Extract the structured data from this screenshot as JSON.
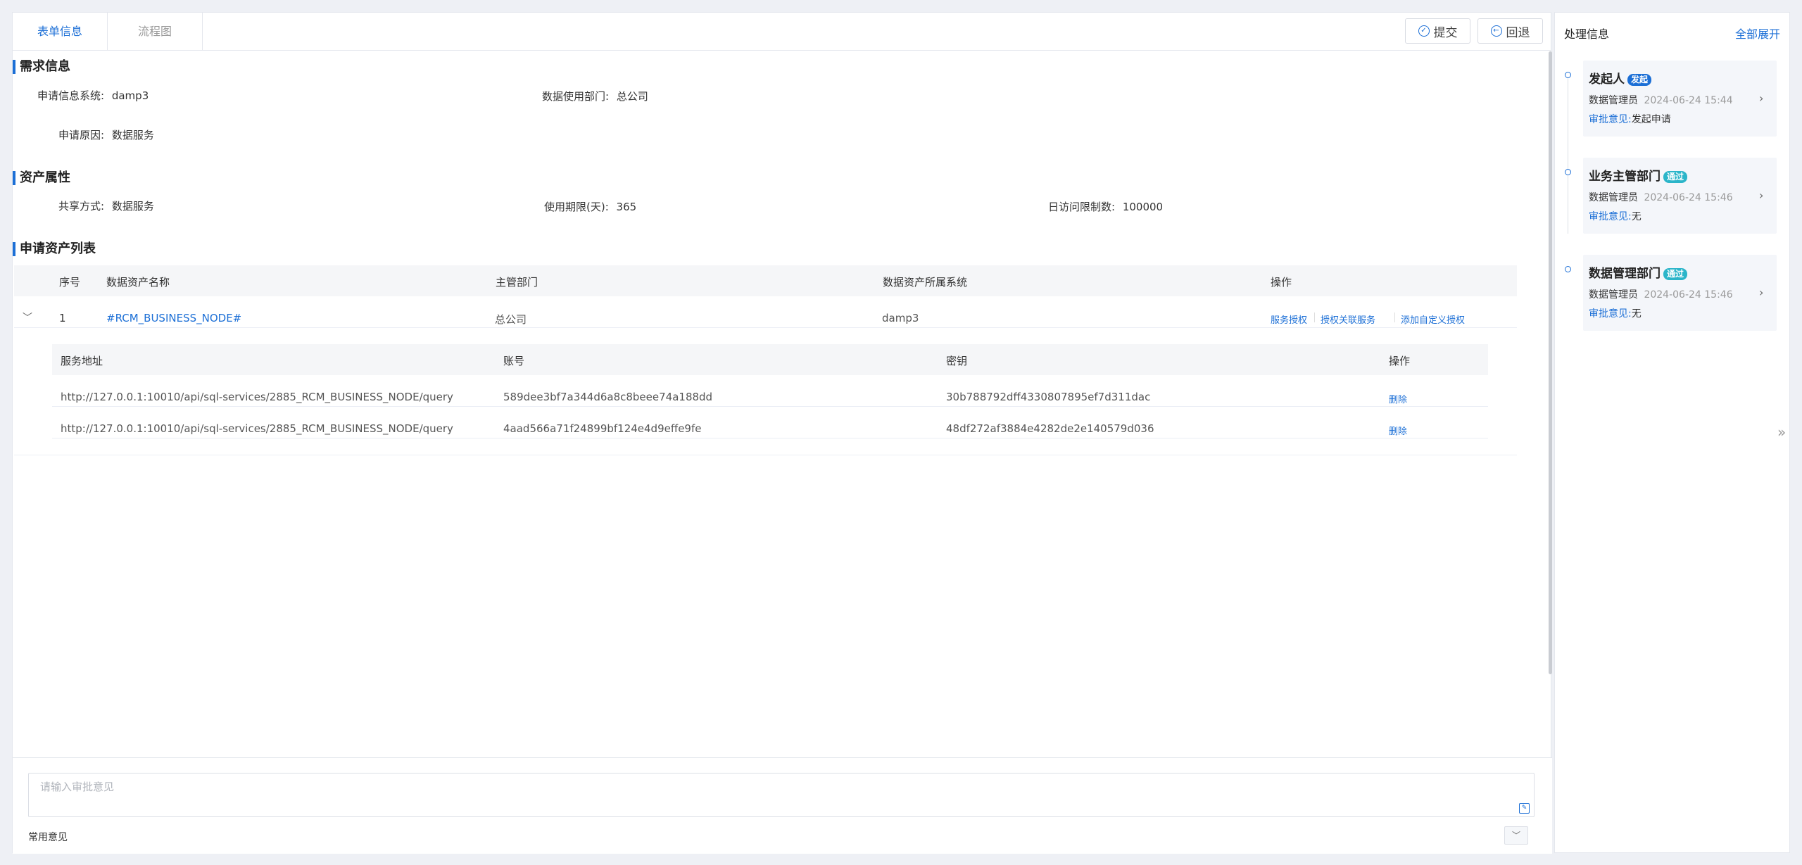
{
  "tabs": [
    {
      "label": "表单信息",
      "active": true
    },
    {
      "label": "流程图",
      "active": false
    }
  ],
  "toolbar": {
    "submit_label": "提交",
    "back_label": "回退"
  },
  "sections": {
    "demand": "需求信息",
    "asset_props": "资产属性",
    "asset_list": "申请资产列表"
  },
  "demand": {
    "system_label": "申请信息系统:",
    "system_value": "damp3",
    "dept_label": "数据使用部门:",
    "dept_value": "总公司",
    "reason_label": "申请原因:",
    "reason_value": "数据服务"
  },
  "asset_props": {
    "share_label": "共享方式:",
    "share_value": "数据服务",
    "period_label": "使用期限(天):",
    "period_value": "365",
    "limit_label": "日访问限制数:",
    "limit_value": "100000"
  },
  "asset_table": {
    "headers": [
      "序号",
      "数据资产名称",
      "主管部门",
      "数据资产所属系统",
      "操作"
    ],
    "rows": [
      {
        "index": "1",
        "name": "#RCM_BUSINESS_NODE#",
        "dept": "总公司",
        "system": "damp3",
        "actions": [
          "服务授权",
          "授权关联服务",
          "添加自定义授权"
        ]
      }
    ]
  },
  "service_table": {
    "headers": [
      "服务地址",
      "账号",
      "密钥",
      "操作"
    ],
    "rows": [
      {
        "url": "http://127.0.0.1:10010/api/sql-services/2885_RCM_BUSINESS_NODE/query",
        "account": "589dee3bf7a344d6a8c8beee74a188dd",
        "secret": "30b788792dff4330807895ef7d311dac",
        "action": "删除"
      },
      {
        "url": "http://127.0.0.1:10010/api/sql-services/2885_RCM_BUSINESS_NODE/query",
        "account": "4aad566a71f24899bf124e4d9effe9fe",
        "secret": "48df272af3884e4282de2e140579d036",
        "action": "删除"
      }
    ]
  },
  "opinion": {
    "placeholder": "请输入审批意见",
    "common_label": "常用意见"
  },
  "right_panel": {
    "title": "处理信息",
    "expand_all": "全部展开",
    "opinion_label": "审批意见:",
    "nodes": [
      {
        "title": "发起人",
        "badge": "发起",
        "badge_color": "#1c6fd6",
        "user": "数据管理员",
        "time": "2024-06-24 15:44",
        "opinion": "发起申请"
      },
      {
        "title": "业务主管部门",
        "badge": "通过",
        "badge_color": "#2bb5c9",
        "user": "数据管理员",
        "time": "2024-06-24 15:46",
        "opinion": "无"
      },
      {
        "title": "数据管理部门",
        "badge": "通过",
        "badge_color": "#2bb5c9",
        "user": "数据管理员",
        "time": "2024-06-24 15:46",
        "opinion": "无"
      }
    ]
  },
  "colors": {
    "accent": "#1c6fd6",
    "badge_pass": "#2bb5c9",
    "bg": "#eef0f5"
  }
}
